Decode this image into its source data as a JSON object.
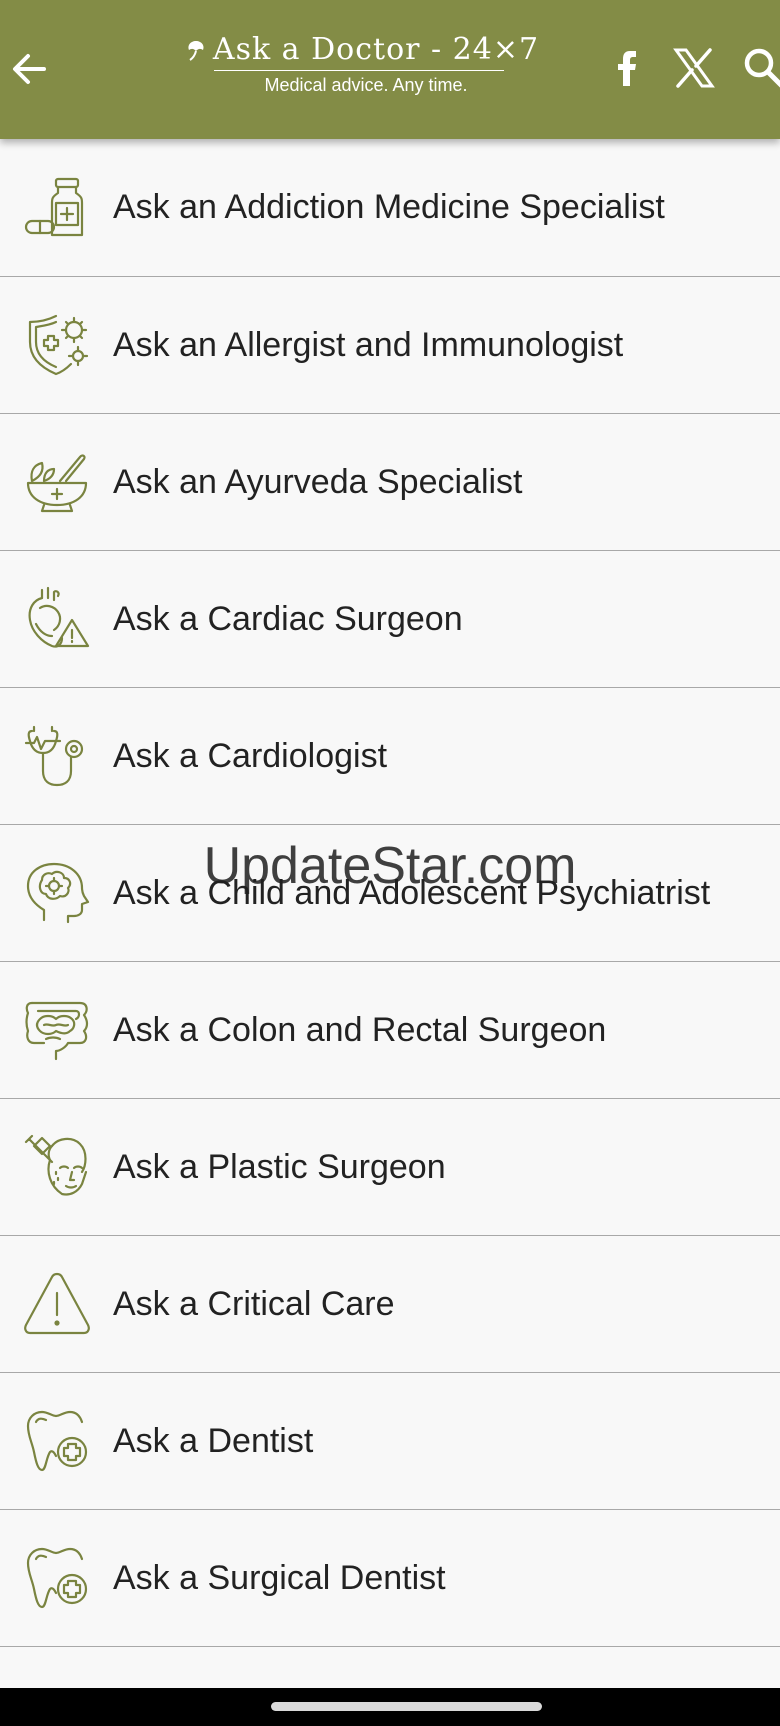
{
  "header": {
    "brand_title": "Ask a Doctor - 24×7",
    "brand_tagline": "Medical advice. Any time.",
    "colors": {
      "bar": "#838c46",
      "icon": "#ffffff"
    },
    "icons": [
      "back-arrow-icon",
      "leaf-logo-icon",
      "facebook-icon",
      "x-icon",
      "search-icon"
    ]
  },
  "items": [
    {
      "label": "Ask an Addiction Medicine Specialist",
      "icon": "medicine-bottle-icon"
    },
    {
      "label": "Ask an Allergist and Immunologist",
      "icon": "shield-virus-icon"
    },
    {
      "label": "Ask an Ayurveda Specialist",
      "icon": "mortar-pestle-icon"
    },
    {
      "label": "Ask a Cardiac Surgeon",
      "icon": "heart-warning-icon"
    },
    {
      "label": "Ask a Cardiologist",
      "icon": "stethoscope-icon"
    },
    {
      "label": "Ask a Child and Adolescent Psychiatrist",
      "icon": "head-brain-icon"
    },
    {
      "label": "Ask a Colon and Rectal Surgeon",
      "icon": "intestine-icon"
    },
    {
      "label": "Ask a Plastic Surgeon",
      "icon": "face-injection-icon"
    },
    {
      "label": "Ask a Critical Care",
      "icon": "warning-triangle-icon"
    },
    {
      "label": "Ask a Dentist",
      "icon": "tooth-plus-icon"
    },
    {
      "label": "Ask a Surgical Dentist",
      "icon": "tooth-plus-icon"
    }
  ],
  "watermark": "UpdateStar.com",
  "accent_color": "#7a8440"
}
